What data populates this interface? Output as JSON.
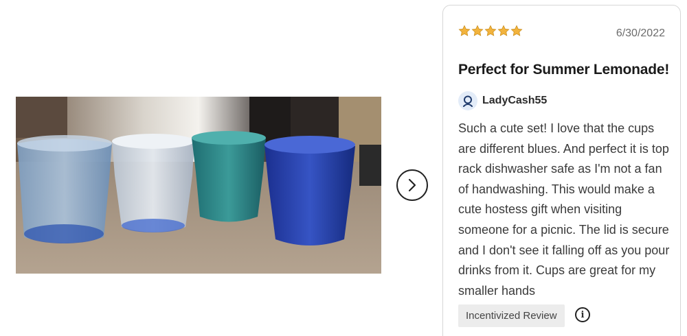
{
  "photo": {
    "icon": "review-photo-drinking-cups"
  },
  "carousel": {
    "next_icon": "chevron-right-icon"
  },
  "review": {
    "rating": 5,
    "rating_max": 5,
    "star_color": "#f2b33d",
    "date": "6/30/2022",
    "title": "Perfect for Summer Lemonade!",
    "author": "LadyCash55",
    "avatar_icon": "user-icon",
    "avatar_color": "#1f3a6b",
    "body": "Such a cute set! I love that the cups are different blues. And perfect it is top rack dishwasher safe as I'm not a fan of handwashing. This would make a cute hostess gift when visiting someone for a picnic. The lid is secure and I don't see it falling off as you pour drinks from it. Cups are great for my smaller hands",
    "badge": "Incentivized Review",
    "info_icon": "info-icon",
    "info_glyph": "i"
  }
}
